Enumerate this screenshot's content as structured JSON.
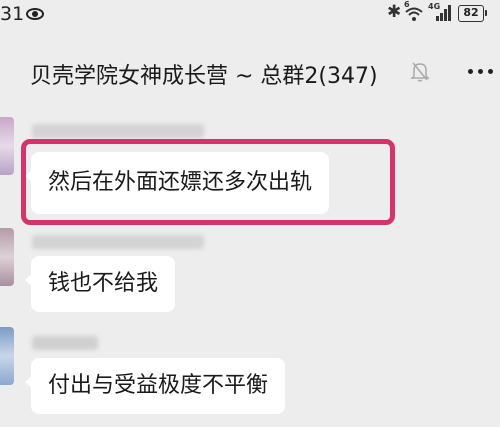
{
  "status_bar": {
    "time": "31",
    "network_label": "4G",
    "wifi_label": "6",
    "battery": "82"
  },
  "header": {
    "title": "贝壳学院女神成长营 ~ 总群2(347)",
    "icons": [
      "mute-bell-icon",
      "more-icon"
    ]
  },
  "messages": [
    {
      "text": "然后在外面还嫖还多次出轨",
      "highlighted": true
    },
    {
      "text": "钱也不给我",
      "highlighted": false
    },
    {
      "text": "付出与受益极度不平衡",
      "highlighted": false
    }
  ],
  "colors": {
    "background": "#ededed",
    "bubble": "#ffffff",
    "highlight_frame": "#d6336c"
  }
}
